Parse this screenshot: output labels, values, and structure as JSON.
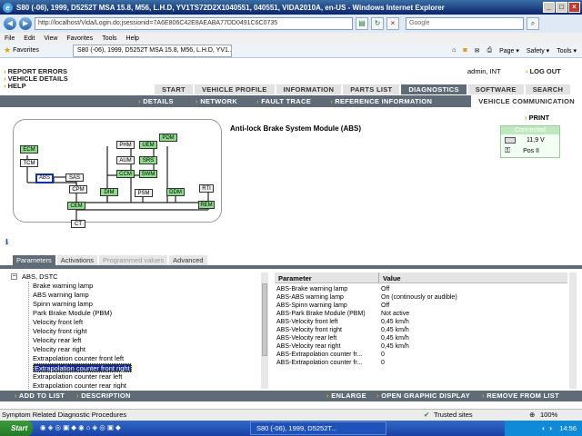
{
  "browser": {
    "window_title": "S80 (-06), 1999, D5252T MSA 15.8, M56, L.H.D, YV1TS72D2X1040551, 040551, VIDA2010A, en-US - Windows Internet Explorer",
    "address": "http://localhost/Vida/Login.do;jsessionid=7A6E806C42E8AEABA77DD0491C6C0735",
    "search_placeholder": "Google",
    "menu": [
      "File",
      "Edit",
      "View",
      "Favorites",
      "Tools",
      "Help"
    ],
    "favorites_label": "Favorites",
    "tab_title": "S80 (-06), 1999, D5252T MSA 15.8, M56, L.H.D, YV1...",
    "toolbar_right": [
      "Page ▾",
      "Safety ▾",
      "Tools ▾"
    ],
    "status_text": "Symptom Related Diagnostic Procedures",
    "zone": "Trusted sites",
    "zoom": "100%"
  },
  "vida": {
    "top_links": [
      "REPORT ERRORS",
      "VEHICLE DETAILS",
      "HELP"
    ],
    "user": "admin, INT",
    "logout": "LOG OUT",
    "main_tabs": [
      "START",
      "VEHICLE PROFILE",
      "INFORMATION",
      "PARTS LIST",
      "DIAGNOSTICS",
      "SOFTWARE",
      "SEARCH"
    ],
    "active_main_tab": "DIAGNOSTICS",
    "sub_nav": [
      "DETAILS",
      "NETWORK",
      "FAULT TRACE",
      "REFERENCE INFORMATION"
    ],
    "vehicle_communication": "VEHICLE COMMUNICATION",
    "print": "PRINT",
    "module_title": "Anti-lock Brake System Module (ABS)",
    "connection": {
      "status": "Connected",
      "voltage": "11,9 V",
      "key_position": "Pos II"
    },
    "modules": [
      "ECM",
      "TCM",
      "ABS",
      "SAS",
      "PHM",
      "AUM",
      "CCM",
      "UEM",
      "SRS",
      "SWM",
      "PDM",
      "CPM",
      "CEM",
      "CT",
      "DIM",
      "PSM",
      "DDM",
      "RTI",
      "REM"
    ],
    "param_tabs": [
      "Parameters",
      "Activations",
      "Programmed values",
      "Advanced"
    ],
    "tree_root": "ABS, DSTC",
    "tree_items": [
      "Brake warning lamp",
      "ABS warning lamp",
      "Spinn warning lamp",
      "Park Brake Module (PBM)",
      "Velocity front left",
      "Velocity front right",
      "Velocity rear left",
      "Velocity rear right",
      "Extrapolation counter front left",
      "Extrapolation counter front right",
      "Extrapolation counter rear left",
      "Extrapolation counter rear right"
    ],
    "tree_selected": "Extrapolation counter front right",
    "table": {
      "headers": [
        "Parameter",
        "Value"
      ],
      "rows": [
        [
          "ABS-Brake warning lamp",
          "Off"
        ],
        [
          "ABS-ABS warning lamp",
          "On (continously or audible)"
        ],
        [
          "ABS-Spinn warning lamp",
          "Off"
        ],
        [
          "ABS-Park Brake Module (PBM)",
          "Not active"
        ],
        [
          "ABS-Velocity front left",
          "0,45 km/h"
        ],
        [
          "ABS-Velocity front right",
          "0,45 km/h"
        ],
        [
          "ABS-Velocity rear left",
          "0,45 km/h"
        ],
        [
          "ABS-Velocity rear right",
          "0,45 km/h"
        ],
        [
          "ABS-Extrapolation counter fr...",
          "0"
        ],
        [
          "ABS-Extrapolation counter fr...",
          "0"
        ]
      ]
    },
    "actions": [
      "ADD TO LIST",
      "DESCRIPTION",
      "ENLARGE",
      "OPEN GRAPHIC DISPLAY",
      "REMOVE FROM LIST"
    ]
  },
  "taskbar": {
    "start": "Start",
    "task": "S80 (-06), 1999, D5252T...",
    "clock": "14:56"
  },
  "colors": {
    "nav": "#5f6b77",
    "module_green": "#8cdc8c",
    "accent": "#e08a00"
  }
}
